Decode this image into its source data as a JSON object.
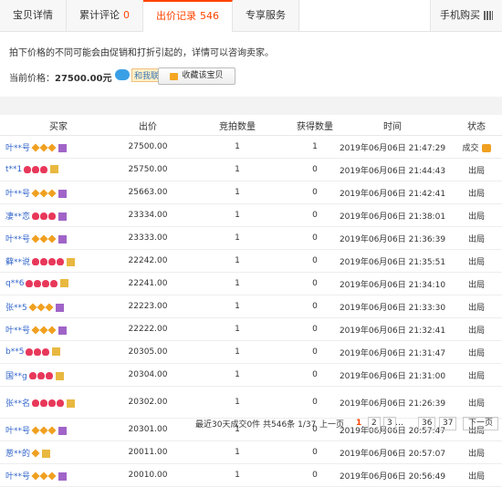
{
  "tabs": [
    {
      "label": "宝贝详情",
      "count": ""
    },
    {
      "label": "累计评论",
      "count": "0"
    },
    {
      "label": "出价记录",
      "count": "546"
    },
    {
      "label": "专享服务",
      "count": ""
    }
  ],
  "mobile_tab": "手机购买",
  "notice": {
    "tip": "拍下价格的不同可能会由促销和打折引起的，详情可以咨询卖家。",
    "price_label": "当前价格：",
    "price_value": "27500.00元",
    "contact_label": "和我联系",
    "favorite_label": "收藏该宝贝"
  },
  "table": {
    "headers": [
      "买家",
      "出价",
      "竞拍数量",
      "获得数量",
      "时间",
      "状态"
    ],
    "rows": [
      {
        "buyer": "叶**号",
        "badges": [
          "diamond",
          "diamond",
          "diamond",
          "vp"
        ],
        "bid": "27500.00",
        "qty": "1",
        "won": "1",
        "time": "2019年06月06日 21:47:29",
        "status": "成交"
      },
      {
        "buyer": "t**1",
        "badges": [
          "heart",
          "heart",
          "heart",
          "vg"
        ],
        "bid": "25750.00",
        "qty": "1",
        "won": "0",
        "time": "2019年06月06日 21:44:43",
        "status": "出局"
      },
      {
        "buyer": "叶**号",
        "badges": [
          "diamond",
          "diamond",
          "diamond",
          "vp"
        ],
        "bid": "25663.00",
        "qty": "1",
        "won": "0",
        "time": "2019年06月06日 21:42:41",
        "status": "出局"
      },
      {
        "buyer": "凄**恋",
        "badges": [
          "heart",
          "heart",
          "heart",
          "vp"
        ],
        "bid": "23334.00",
        "qty": "1",
        "won": "0",
        "time": "2019年06月06日 21:38:01",
        "status": "出局"
      },
      {
        "buyer": "叶**号",
        "badges": [
          "diamond",
          "diamond",
          "diamond",
          "vp"
        ],
        "bid": "23333.00",
        "qty": "1",
        "won": "0",
        "time": "2019年06月06日 21:36:39",
        "status": "出局"
      },
      {
        "buyer": "藓**说",
        "badges": [
          "heart",
          "heart",
          "heart",
          "heart",
          "vg"
        ],
        "bid": "22242.00",
        "qty": "1",
        "won": "0",
        "time": "2019年06月06日 21:35:51",
        "status": "出局"
      },
      {
        "buyer": "q**6",
        "badges": [
          "heart",
          "heart",
          "heart",
          "heart",
          "vg"
        ],
        "bid": "22241.00",
        "qty": "1",
        "won": "0",
        "time": "2019年06月06日 21:34:10",
        "status": "出局"
      },
      {
        "buyer": "张**5",
        "badges": [
          "diamond",
          "diamond",
          "diamond",
          "vp"
        ],
        "bid": "22223.00",
        "qty": "1",
        "won": "0",
        "time": "2019年06月06日 21:33:30",
        "status": "出局"
      },
      {
        "buyer": "叶**号",
        "badges": [
          "diamond",
          "diamond",
          "diamond",
          "vp"
        ],
        "bid": "22222.00",
        "qty": "1",
        "won": "0",
        "time": "2019年06月06日 21:32:41",
        "status": "出局"
      },
      {
        "buyer": "b**5",
        "badges": [
          "heart",
          "heart",
          "heart",
          "vg"
        ],
        "bid": "20305.00",
        "qty": "1",
        "won": "0",
        "time": "2019年06月06日 21:31:47",
        "status": "出局"
      },
      {
        "buyer": "国**g",
        "badges": [
          "heart",
          "heart",
          "heart",
          "vg"
        ],
        "bid": "20304.00",
        "qty": "1",
        "won": "0",
        "time": "2019年06月06日 21:31:00",
        "status": "出局"
      },
      {
        "buyer": "张**名",
        "badges": [
          "heart",
          "heart",
          "heart",
          "heart",
          "vg"
        ],
        "bid": "20302.00",
        "qty": "1",
        "won": "0",
        "time": "2019年06月06日 21:26:39",
        "status": "出局",
        "tall": true
      },
      {
        "buyer": "叶**号",
        "badges": [
          "diamond",
          "diamond",
          "diamond",
          "vp"
        ],
        "bid": "20301.00",
        "qty": "1",
        "won": "0",
        "time": "2019年06月06日 20:57:47",
        "status": "出局"
      },
      {
        "buyer": "葱**的",
        "badges": [
          "diamond",
          "vg"
        ],
        "bid": "20011.00",
        "qty": "1",
        "won": "0",
        "time": "2019年06月06日 20:57:07",
        "status": "出局"
      },
      {
        "buyer": "叶**号",
        "badges": [
          "diamond",
          "diamond",
          "diamond",
          "vp"
        ],
        "bid": "20010.00",
        "qty": "1",
        "won": "0",
        "time": "2019年06月06日 20:56:49",
        "status": "出局"
      }
    ]
  },
  "pager": {
    "summary": "最近30天成交0件 共546条 1/37",
    "prev": "上一页",
    "pages": [
      "1",
      "2",
      "3"
    ],
    "ellipsis": "…",
    "tail_pages": [
      "36",
      "37"
    ],
    "next": "下一页"
  }
}
